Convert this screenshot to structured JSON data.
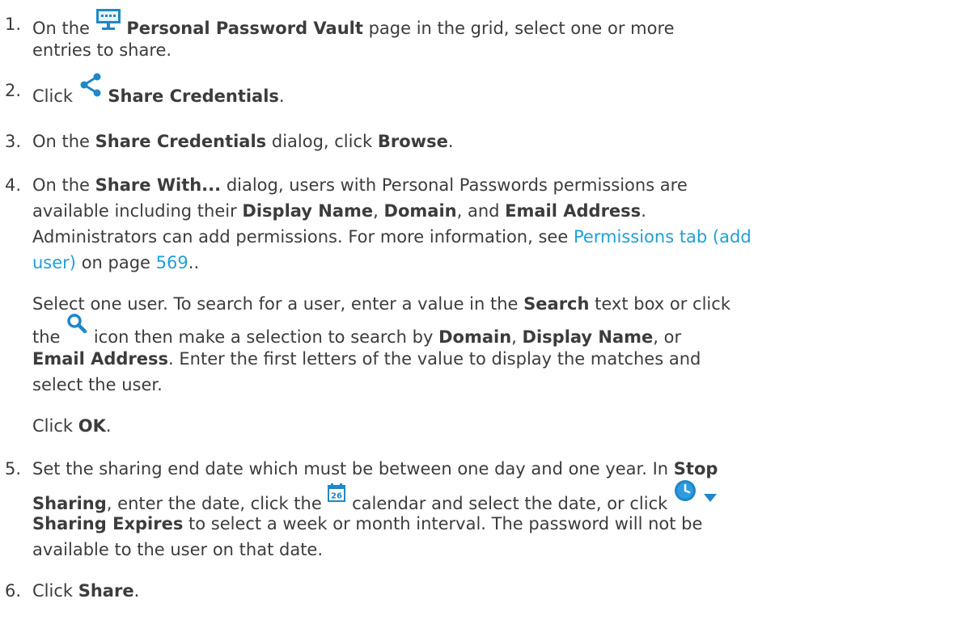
{
  "steps": [
    {
      "number": "1.",
      "line1_a": "On the",
      "line1_bold": "Personal Password Vault",
      "line1_b": "page in the grid, select one or more",
      "line2": "entries to share."
    },
    {
      "number": "2.",
      "text": "Click",
      "bold": "Share Credentials",
      "end": "."
    },
    {
      "number": "3.",
      "a": "On the",
      "bold1": "Share Credentials",
      "b": "dialog, click",
      "bold2": "Browse",
      "end": "."
    },
    {
      "number": "4.",
      "l1_a": "On the",
      "l1_bold": "Share With...",
      "l1_b": "dialog, users with Personal Passwords permissions are",
      "l2_a": "available including their",
      "l2_bold1": "Display Name",
      "l2_sep1": ",",
      "l2_bold2": "Domain",
      "l2_sep2": ", and",
      "l2_bold3": "Email Address",
      "l2_end": ".",
      "l3_a": "Administrators can add permissions. For more information, see",
      "l3_link": "Permissions tab (add",
      "l4_link": "user)",
      "l4_a": "on page",
      "l4_page": "569",
      "l4_end": "..",
      "p2_l1_a": "Select one user. To search for a user, enter a value in the",
      "p2_l1_bold": "Search",
      "p2_l1_b": "text box or click",
      "p2_l2_a": "the",
      "p2_l2_b": "icon then make a selection to search by",
      "p2_l2_bold1": "Domain",
      "p2_l2_sep1": ",",
      "p2_l2_bold2": "Display Name",
      "p2_l2_sep2": ", or",
      "p2_l3_bold": "Email Address",
      "p2_l3_a": ". Enter the first letters of the value to display the matches and",
      "p2_l4": "select the user.",
      "p3_a": "Click",
      "p3_bold": "OK",
      "p3_end": "."
    },
    {
      "number": "5.",
      "l1_a": "Set the sharing end date which must be between one day and one year. In",
      "l1_bold": "Stop",
      "l2_bold": "Sharing",
      "l2_a": ", enter the date, click the",
      "l2_b": "calendar and select the date, or click",
      "l3_bold": "Sharing Expires",
      "l3_a": "to select a week or month interval. The password will not be",
      "l4": "available to the user on that date."
    },
    {
      "number": "6.",
      "text": "Click",
      "bold": "Share",
      "end": "."
    }
  ],
  "icons": {
    "vault": "personal-password-vault-icon",
    "share": "share-icon",
    "search": "search-icon",
    "calendar": "calendar-icon",
    "calendar_day": "26",
    "clock": "clock-icon",
    "dropdown": "dropdown-arrow-icon"
  },
  "colors": {
    "text": "#3c3c3c",
    "link": "#1fa0d8",
    "icon_blue": "#1e88c8"
  }
}
